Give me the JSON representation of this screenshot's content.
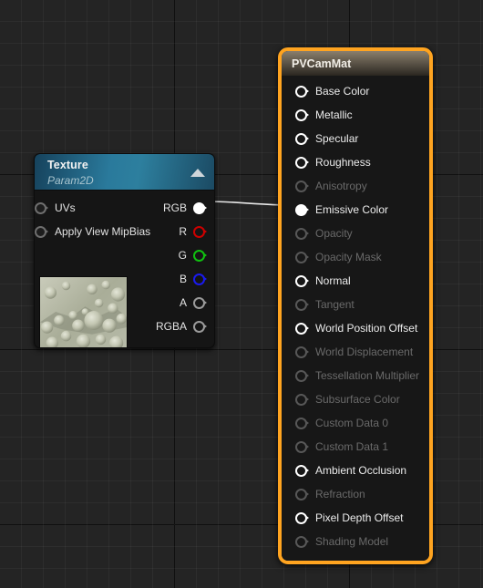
{
  "app": {
    "context": "unreal-material-graph",
    "background_color": "#242424",
    "grid_minor_color": "#2e2e2e",
    "grid_major_color": "#060606"
  },
  "texture_node": {
    "title": "Texture",
    "subtitle": "Param2D",
    "header_gradient": [
      "#16425c",
      "#2d7f9e"
    ],
    "collapse_icon": "chevron-up-icon",
    "inputs": [
      {
        "label": "UVs",
        "pin": "dark",
        "connected": false
      },
      {
        "label": "Apply View MipBias",
        "pin": "dark",
        "connected": false
      }
    ],
    "outputs": [
      {
        "label": "RGB",
        "pin": "filled",
        "color": "#ffffff",
        "connected": true
      },
      {
        "label": "R",
        "pin": "red",
        "color": "#cc0000",
        "connected": false
      },
      {
        "label": "G",
        "pin": "green",
        "color": "#10c010",
        "connected": false
      },
      {
        "label": "B",
        "pin": "blue",
        "color": "#1a1aee",
        "connected": false
      },
      {
        "label": "A",
        "pin": "gray",
        "color": "#9a9a9a",
        "connected": false
      },
      {
        "label": "RGBA",
        "pin": "gray",
        "color": "#9a9a9a",
        "connected": false
      }
    ],
    "thumbnail": {
      "name": "texture-preview-thumbnail",
      "description": "pale grey-green bubbled surface texture"
    }
  },
  "material_node": {
    "title": "PVCamMat",
    "border_color": "#ffa420",
    "selected": true,
    "inputs": [
      {
        "label": "Base Color",
        "enabled": true,
        "connected": false
      },
      {
        "label": "Metallic",
        "enabled": true,
        "connected": false
      },
      {
        "label": "Specular",
        "enabled": true,
        "connected": false
      },
      {
        "label": "Roughness",
        "enabled": true,
        "connected": false
      },
      {
        "label": "Anisotropy",
        "enabled": false,
        "connected": false
      },
      {
        "label": "Emissive Color",
        "enabled": true,
        "connected": true
      },
      {
        "label": "Opacity",
        "enabled": false,
        "connected": false
      },
      {
        "label": "Opacity Mask",
        "enabled": false,
        "connected": false
      },
      {
        "label": "Normal",
        "enabled": true,
        "connected": false
      },
      {
        "label": "Tangent",
        "enabled": false,
        "connected": false
      },
      {
        "label": "World Position Offset",
        "enabled": true,
        "connected": false
      },
      {
        "label": "World Displacement",
        "enabled": false,
        "connected": false
      },
      {
        "label": "Tessellation Multiplier",
        "enabled": false,
        "connected": false
      },
      {
        "label": "Subsurface Color",
        "enabled": false,
        "connected": false
      },
      {
        "label": "Custom Data 0",
        "enabled": false,
        "connected": false
      },
      {
        "label": "Custom Data 1",
        "enabled": false,
        "connected": false
      },
      {
        "label": "Ambient Occlusion",
        "enabled": true,
        "connected": false
      },
      {
        "label": "Refraction",
        "enabled": false,
        "connected": false
      },
      {
        "label": "Pixel Depth Offset",
        "enabled": true,
        "connected": false
      },
      {
        "label": "Shading Model",
        "enabled": false,
        "connected": false
      }
    ]
  },
  "connection": {
    "name": "wire-rgb-to-emissive-color",
    "from": "Texture.RGB",
    "to": "PVCamMat.Emissive Color",
    "color": "#e8e8e8"
  }
}
